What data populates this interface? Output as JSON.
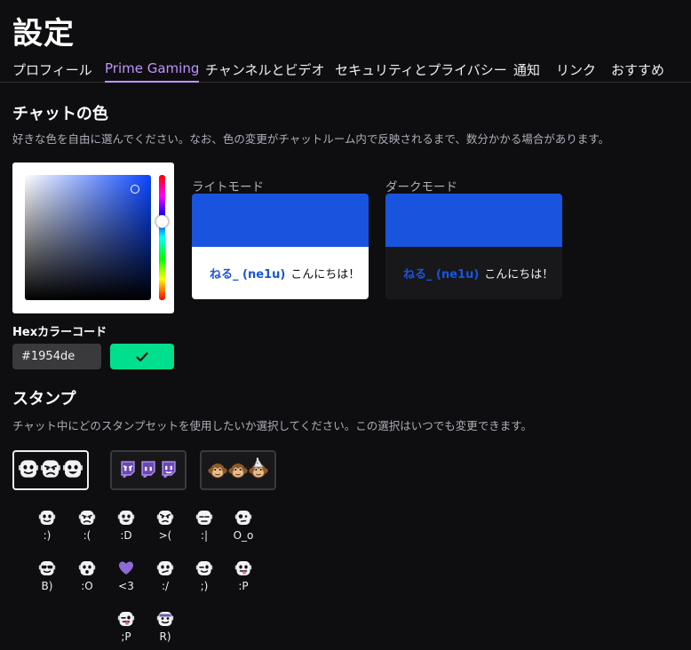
{
  "page": {
    "title": "設定"
  },
  "tabs": [
    {
      "label": "プロフィール",
      "active": false
    },
    {
      "label": "Prime Gaming",
      "active": true
    },
    {
      "label": "チャンネルとビデオ",
      "active": false
    },
    {
      "label": "セキュリティとプライバシー",
      "active": false
    },
    {
      "label": "通知",
      "active": false
    },
    {
      "label": "リンク",
      "active": false
    },
    {
      "label": "おすすめ",
      "active": false
    }
  ],
  "chat_color": {
    "title": "チャットの色",
    "description": "好きな色を自由に選んでください。なお、色の変更がチャットルーム内で反映されるまで、数分かかる場合があります。",
    "selected_color": "#1954de",
    "light_mode": {
      "label": "ライトモード",
      "username": "ねる_ (ne1u)",
      "message": "こんにちは！",
      "bg": "#ffffff",
      "text": "#0e0e10"
    },
    "dark_mode": {
      "label": "ダークモード",
      "username": "ねる_ (ne1u)",
      "message": "こんにちは！",
      "bg": "#18181b",
      "text": "#efeff1"
    },
    "hex_label": "Hexカラーコード",
    "hex_value": "#1954de",
    "confirm_icon": "check-icon",
    "confirm_color": "#00e08c"
  },
  "stamps": {
    "title": "スタンプ",
    "description": "チャット中にどのスタンプセットを使用したいか選択してください。この選択はいつでも変更できます。",
    "sets": [
      {
        "name": "robot-emote-set",
        "selected": true
      },
      {
        "name": "glitch-emote-set",
        "selected": false
      },
      {
        "name": "monkey-emote-set",
        "selected": false
      }
    ],
    "emotes": [
      {
        "code": ":)",
        "face": "smile"
      },
      {
        "code": ":(",
        "face": "sad"
      },
      {
        "code": ":D",
        "face": "grin"
      },
      {
        "code": ">(",
        "face": "angry"
      },
      {
        "code": ":|",
        "face": "neutral"
      },
      {
        "code": "O_o",
        "face": "confused"
      },
      {
        "code": "B)",
        "face": "sunglasses"
      },
      {
        "code": ":O",
        "face": "surprised"
      },
      {
        "code": "<3",
        "face": "heart"
      },
      {
        "code": ":/",
        "face": "meh"
      },
      {
        "code": ";)",
        "face": "wink"
      },
      {
        "code": ":P",
        "face": "tongue"
      },
      {
        "code": ";P",
        "face": "wink-tongue"
      },
      {
        "code": "R)",
        "face": "pirate"
      }
    ]
  }
}
